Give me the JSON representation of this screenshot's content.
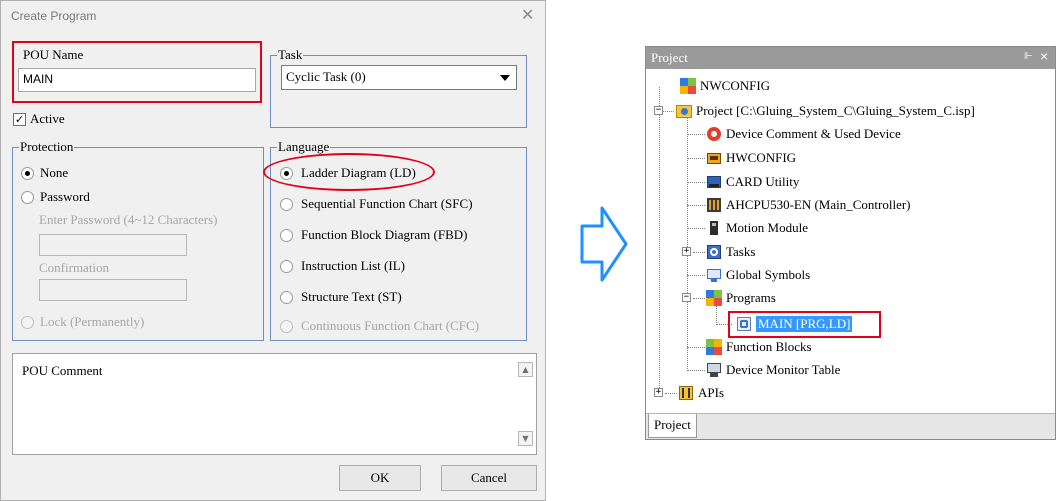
{
  "dialog": {
    "title": "Create Program",
    "pou_name_label": "POU Name",
    "pou_name_value": "MAIN",
    "task_label": "Task",
    "task_value": "Cyclic Task (0)",
    "active_label": "Active",
    "active_checked": true,
    "protection_label": "Protection",
    "protection_none": "None",
    "protection_password": "Password",
    "enter_password_label": "Enter Password (4~12 Characters)",
    "confirmation_label": "Confirmation",
    "lock_label": "Lock (Permanently)",
    "language_label": "Language",
    "languages": [
      "Ladder Diagram (LD)",
      "Sequential Function Chart (SFC)",
      "Function Block Diagram (FBD)",
      "Instruction List (IL)",
      "Structure Text (ST)",
      "Continuous Function Chart (CFC)"
    ],
    "pou_comment_label": "POU Comment",
    "ok_label": "OK",
    "cancel_label": "Cancel"
  },
  "project_panel": {
    "title": "Project",
    "pin_icon": "pin-icon",
    "close_icon": "close-icon",
    "tree": [
      {
        "label": "NWCONFIG",
        "icon": "nwconfig-icon"
      },
      {
        "label": "Project [C:\\Gluing_System_C\\Gluing_System_C.isp]",
        "icon": "project-icon"
      },
      {
        "label": "Device Comment & Used Device",
        "icon": "device-comment-icon"
      },
      {
        "label": "HWCONFIG",
        "icon": "hwconfig-icon"
      },
      {
        "label": "CARD Utility",
        "icon": "card-utility-icon"
      },
      {
        "label": "AHCPU530-EN  (Main_Controller)",
        "icon": "cpu-icon"
      },
      {
        "label": "Motion Module",
        "icon": "motion-module-icon"
      },
      {
        "label": "Tasks",
        "icon": "tasks-icon"
      },
      {
        "label": "Global Symbols",
        "icon": "global-symbols-icon"
      },
      {
        "label": "Programs",
        "icon": "programs-icon"
      },
      {
        "label": "MAIN [PRG,LD]",
        "icon": "program-item-icon"
      },
      {
        "label": "Function Blocks",
        "icon": "function-blocks-icon"
      },
      {
        "label": "Device Monitor Table",
        "icon": "device-monitor-icon"
      },
      {
        "label": "APIs",
        "icon": "apis-icon"
      }
    ],
    "bottom_tab": "Project"
  },
  "colors": {
    "highlight_red": "#e3001b",
    "selection_blue": "#3399ff",
    "arrow_blue": "#1e90ff",
    "group_border": "#6f8fbf",
    "panel_header": "#9a9a9a"
  }
}
